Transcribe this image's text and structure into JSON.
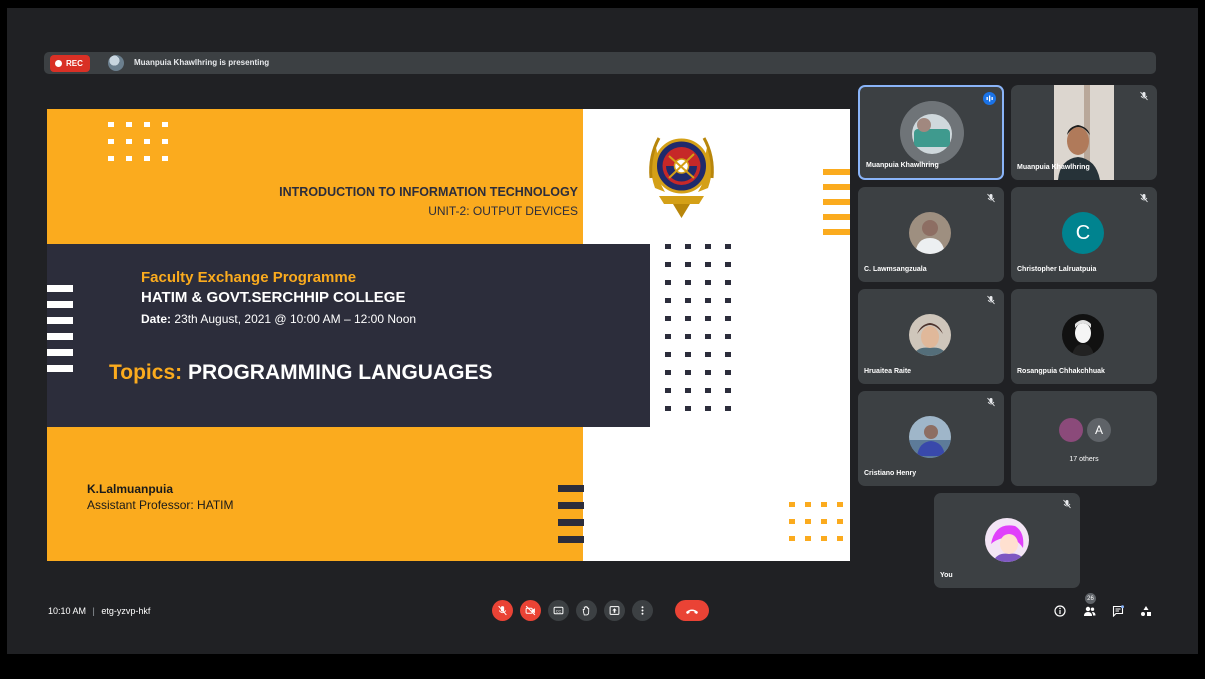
{
  "recording": {
    "label": "REC"
  },
  "presenting_text": "Muanpuia Khawlhring is presenting",
  "slide": {
    "title": "INTRODUCTION TO INFORMATION TECHNOLOGY",
    "subtitle": "UNIT-2: OUTPUT DEVICES",
    "event": "Faculty Exchange Programme",
    "colleges": "HATIM & GOVT.SERCHHIP COLLEGE",
    "date_label": "Date:",
    "date_value": " 23th August, 2021 @ 10:00 AM – 12:00 Noon",
    "topics_label": "Topics:",
    "topics_value": " PROGRAMMING LANGUAGES",
    "presenter_name": "K.Lalmuanpuia",
    "presenter_role": "Assistant  Professor: HATIM"
  },
  "participants": [
    {
      "name": "Muanpuia Khawlhring",
      "state": "speaking"
    },
    {
      "name": "Muanpuia Khawlhring",
      "state": "muted"
    },
    {
      "name": "C. Lawmsangzuala",
      "state": "muted"
    },
    {
      "name": "Christopher Lalruatpuia",
      "state": "muted",
      "initial": "C"
    },
    {
      "name": "Hruaitea Raite",
      "state": "muted"
    },
    {
      "name": "Rosangpuia Chhakchhuak",
      "state": "muted"
    },
    {
      "name": "Cristiano Henry",
      "state": "muted"
    },
    {
      "name": "17 others",
      "initial": "A"
    },
    {
      "name": "You",
      "state": "muted"
    }
  ],
  "meeting": {
    "time": "10:10 AM",
    "separator": "|",
    "code": "etg-yzvp-hkf",
    "participant_count": "26"
  },
  "colors": {
    "accent_orange": "#fbab1e",
    "slide_dark": "#2c2d3b",
    "danger": "#ea4335",
    "meet_bg": "#202124",
    "tile_bg": "#3c4043",
    "active_border": "#8ab4f8"
  },
  "icons": [
    "mic-off-icon",
    "camera-off-icon",
    "captions-icon",
    "raise-hand-icon",
    "present-screen-icon",
    "more-options-icon",
    "end-call-icon",
    "info-icon",
    "people-icon",
    "chat-icon",
    "activities-icon"
  ]
}
